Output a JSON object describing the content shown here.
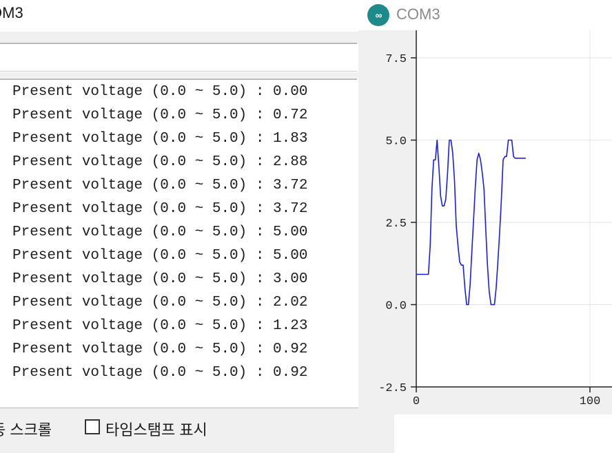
{
  "monitor": {
    "title": "OM3",
    "lines": [
      "Present voltage (0.0 ~ 5.0) : 0.00",
      "Present voltage (0.0 ~ 5.0) : 0.72",
      "Present voltage (0.0 ~ 5.0) : 1.83",
      "Present voltage (0.0 ~ 5.0) : 2.88",
      "Present voltage (0.0 ~ 5.0) : 3.72",
      "Present voltage (0.0 ~ 5.0) : 3.72",
      "Present voltage (0.0 ~ 5.0) : 5.00",
      "Present voltage (0.0 ~ 5.0) : 5.00",
      "Present voltage (0.0 ~ 5.0) : 3.00",
      "Present voltage (0.0 ~ 5.0) : 2.02",
      "Present voltage (0.0 ~ 5.0) : 1.23",
      "Present voltage (0.0 ~ 5.0) : 0.92",
      "Present voltage (0.0 ~ 5.0) : 0.92"
    ],
    "autoscroll_label": "동 스크롤",
    "timestamp_label": "타임스탬프 표시",
    "timestamp_checked": false
  },
  "plotter": {
    "title": "COM3",
    "icon": "arduino-infinity-icon",
    "icon_glyph": "∞",
    "line_color": "#1a1aee"
  },
  "chart_data": {
    "type": "line",
    "y_ticks": [
      "7.5",
      "5.0",
      "2.5",
      "0.0",
      "-2.5"
    ],
    "x_ticks": [
      "0",
      "100"
    ],
    "ylim": [
      -2.5,
      7.5
    ],
    "xlim": [
      0,
      100
    ],
    "grid": true,
    "series": [
      {
        "x": [
          0,
          1,
          2,
          3,
          4,
          5,
          6,
          7,
          8,
          9,
          10,
          11,
          12,
          13,
          14,
          15,
          16,
          17,
          18,
          19,
          20,
          21,
          22,
          23,
          24,
          25,
          26,
          27,
          28,
          29,
          30,
          31,
          32,
          33,
          34,
          35,
          36,
          37,
          38,
          39,
          40,
          41,
          42,
          43,
          44,
          45,
          46,
          47,
          48,
          49,
          50,
          51,
          52,
          53,
          54,
          55,
          56,
          57,
          58,
          59,
          60,
          61,
          62,
          63
        ],
        "values": [
          0.92,
          0.92,
          0.92,
          0.92,
          0.92,
          0.92,
          0.92,
          0.92,
          1.8,
          3.5,
          4.4,
          4.4,
          5.0,
          4.2,
          3.3,
          3.0,
          3.0,
          3.2,
          4.0,
          5.0,
          5.0,
          4.6,
          3.8,
          2.4,
          1.8,
          1.3,
          1.2,
          1.2,
          0.5,
          0.0,
          0.0,
          0.6,
          1.6,
          2.6,
          3.6,
          4.4,
          4.6,
          4.4,
          4.0,
          3.5,
          2.3,
          1.2,
          0.4,
          0.0,
          0.0,
          0.0,
          0.5,
          1.3,
          2.2,
          3.2,
          4.4,
          4.5,
          4.5,
          5.0,
          5.0,
          5.0,
          4.5,
          4.45,
          4.45,
          4.45,
          4.45,
          4.45,
          4.45,
          4.45
        ]
      }
    ]
  }
}
